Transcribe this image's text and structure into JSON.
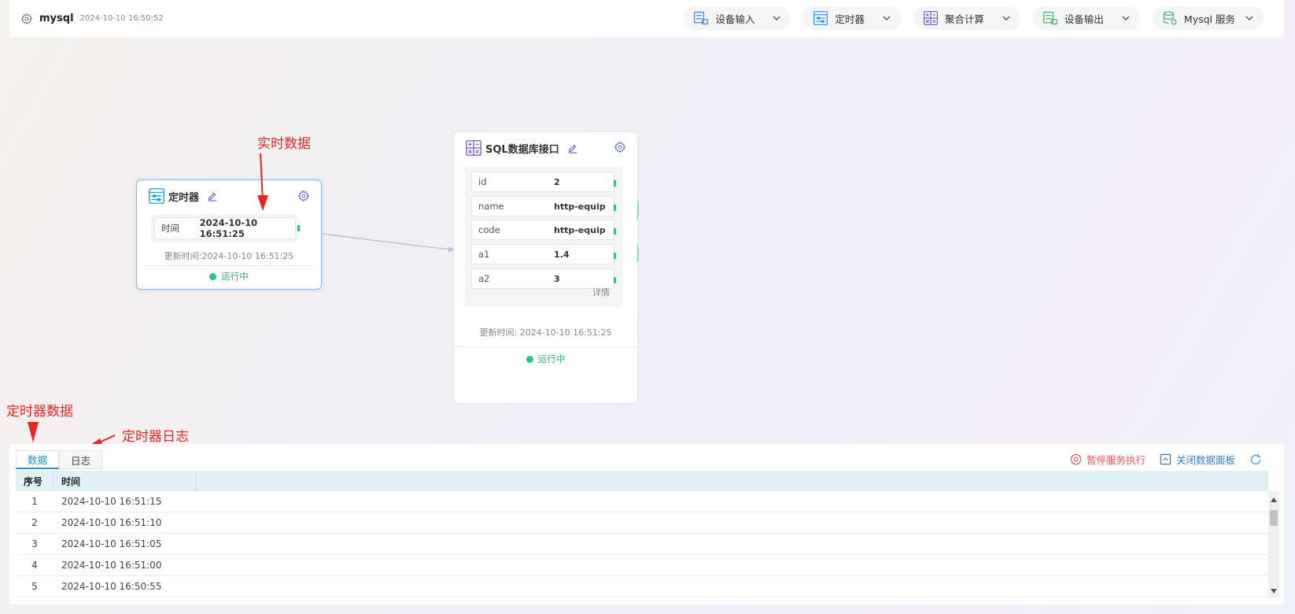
{
  "header": {
    "title": "mysql",
    "timestamp": "2024-10-10 16:50:52",
    "toolbar": [
      {
        "label": "设备输入",
        "icon": "device-input-icon"
      },
      {
        "label": "定时器",
        "icon": "timer-icon"
      },
      {
        "label": "聚合计算",
        "icon": "calculator-icon"
      },
      {
        "label": "设备输出",
        "icon": "device-output-icon"
      },
      {
        "label": "Mysql 服务",
        "icon": "database-icon"
      }
    ]
  },
  "timer_node": {
    "title": "定时器",
    "field_key": "时间",
    "field_value": "2024-10-10 16:51:25",
    "update_text": "更新时间:2024-10-10 16:51:25",
    "status": "运行中"
  },
  "sql_node": {
    "title": "SQL数据库接口",
    "rows": [
      {
        "key": "id",
        "value": "2"
      },
      {
        "key": "name",
        "value": "http-equip"
      },
      {
        "key": "code",
        "value": "http-equip"
      },
      {
        "key": "a1",
        "value": "1.4"
      },
      {
        "key": "a2",
        "value": "3"
      }
    ],
    "detail": "详情",
    "update_text": "更新时间: 2024-10-10 16:51:25",
    "status": "运行中"
  },
  "annotations": {
    "realtime": "实时数据",
    "timer_data": "定时器数据",
    "timer_log": "定时器日志",
    "color": "#e8261f"
  },
  "bottom_panel": {
    "tabs": [
      "数据",
      "日志"
    ],
    "active_tab": "数据",
    "pause_label": "暂停服务执行",
    "close_label": "关闭数据面板",
    "columns": [
      "序号",
      "时间"
    ],
    "rows": [
      {
        "no": "1",
        "time": "2024-10-10 16:51:15"
      },
      {
        "no": "2",
        "time": "2024-10-10 16:51:10"
      },
      {
        "no": "3",
        "time": "2024-10-10 16:51:05"
      },
      {
        "no": "4",
        "time": "2024-10-10 16:51:00"
      },
      {
        "no": "5",
        "time": "2024-10-10 16:50:55"
      }
    ]
  },
  "colors": {
    "accent": "#2a8fd6",
    "running": "#2fbf8c",
    "pause": "#e8565b",
    "port": "#3dbd8f"
  }
}
